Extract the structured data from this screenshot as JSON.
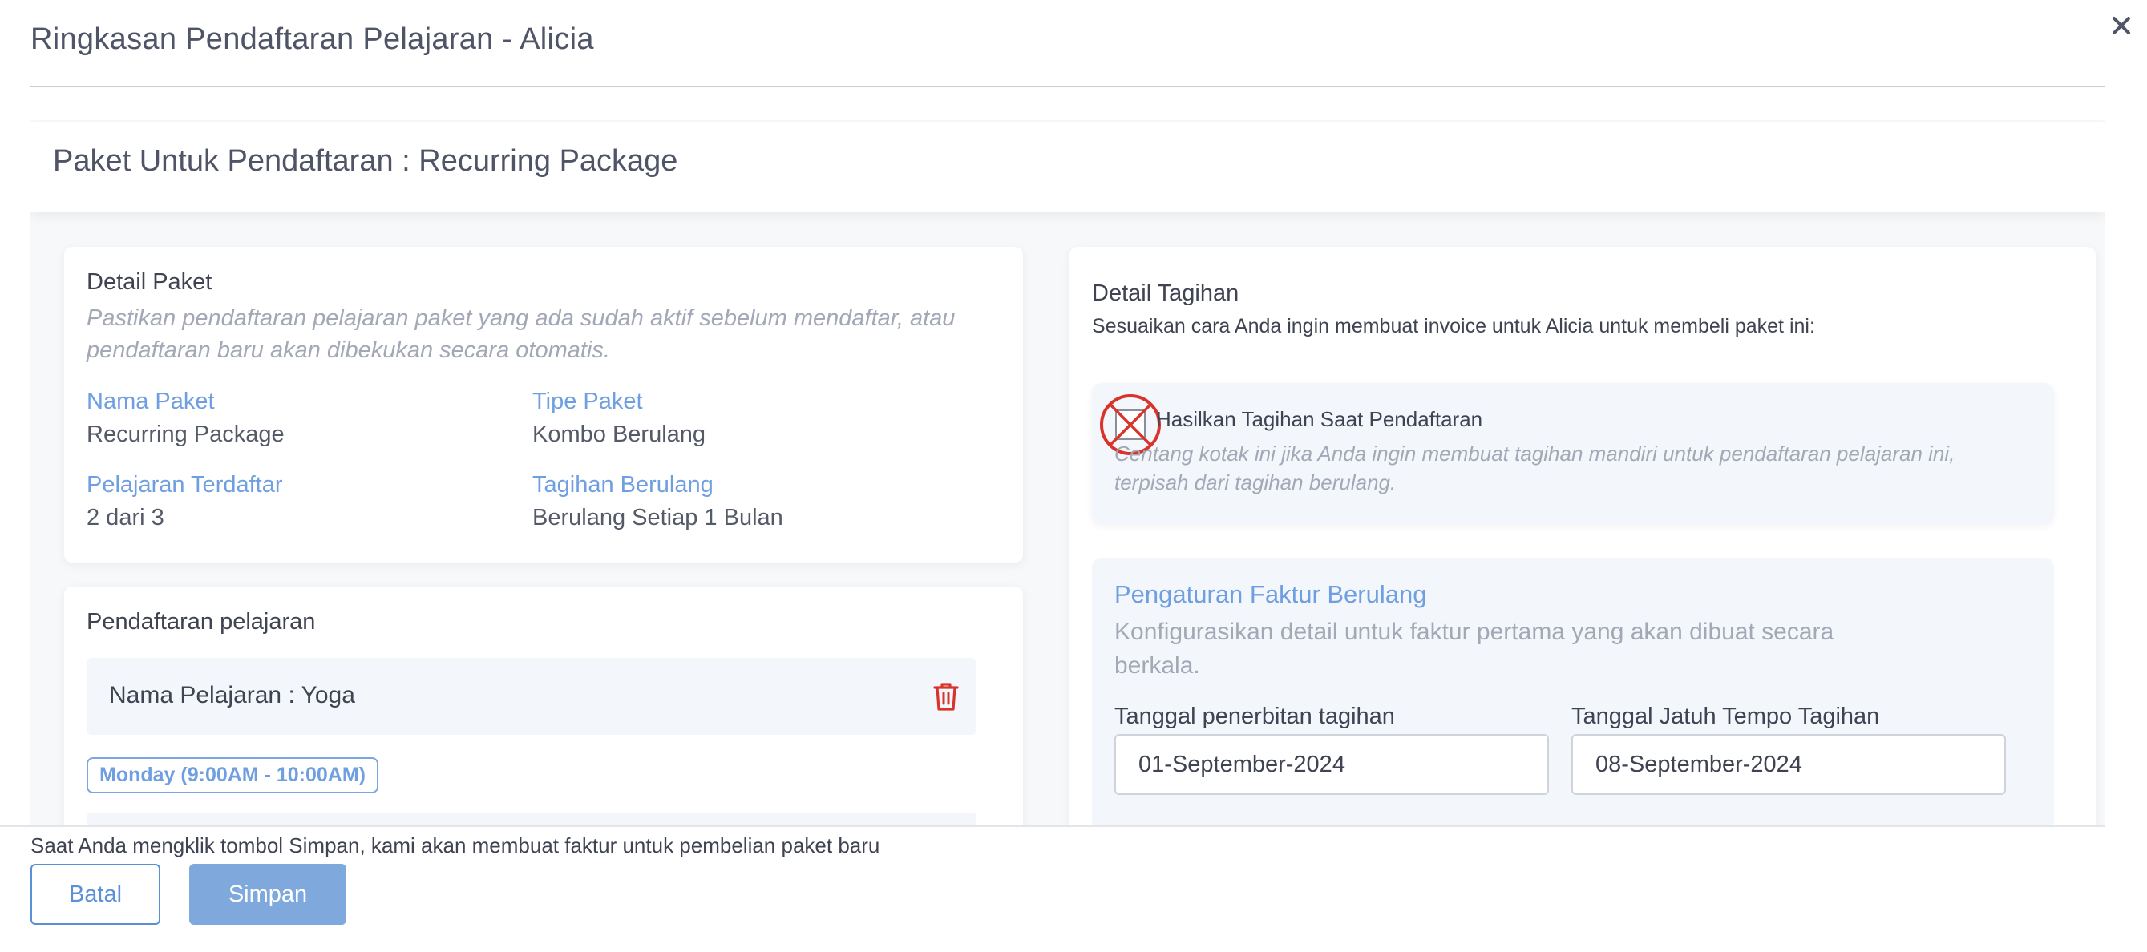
{
  "modal": {
    "title": "Ringkasan Pendaftaran Pelajaran - Alicia",
    "close_icon": "close-icon"
  },
  "package_header": {
    "text": "Paket Untuk Pendaftaran : Recurring Package"
  },
  "package_detail": {
    "title": "Detail Paket",
    "hint": "Pastikan pendaftaran pelajaran paket yang ada sudah aktif sebelum mendaftar, atau pendaftaran baru akan dibekukan secara otomatis.",
    "fields": [
      {
        "label": "Nama Paket",
        "value": "Recurring Package"
      },
      {
        "label": "Tipe Paket",
        "value": "Kombo Berulang"
      },
      {
        "label": "Pelajaran Terdaftar",
        "value": "2 dari 3"
      },
      {
        "label": "Tagihan Berulang",
        "value": "Berulang Setiap 1 Bulan"
      }
    ]
  },
  "enrollment": {
    "title": "Pendaftaran pelajaran",
    "lesson_name": "Nama Pelajaran : Yoga",
    "schedule": "Monday (9:00AM - 10:00AM)",
    "delete_icon": "trash-icon"
  },
  "billing": {
    "title": "Detail Tagihan",
    "subtitle": "Sesuaikan cara Anda ingin membuat invoice untuk Alicia untuk membeli paket ini:",
    "checkbox": {
      "label": "Hasilkan Tagihan Saat Pendaftaran",
      "hint": "Centang kotak ini jika Anda ingin membuat tagihan mandiri untuk pendaftaran pelajaran ini, terpisah dari tagihan berulang.",
      "checked": false
    },
    "recurring": {
      "title": "Pengaturan Faktur Berulang",
      "hint": "Konfigurasikan detail untuk faktur pertama yang akan dibuat secara berkala.",
      "issue_date_label": "Tanggal penerbitan tagihan",
      "issue_date_value": "01-September-2024",
      "due_date_label": "Tanggal Jatuh Tempo Tagihan",
      "due_date_value": "08-September-2024"
    }
  },
  "footer": {
    "note": "Saat Anda mengklik tombol Simpan, kami akan membuat faktur untuk pembelian paket baru",
    "cancel_label": "Batal",
    "save_label": "Simpan"
  },
  "colors": {
    "accent_blue": "#6f9fe0",
    "button_blue": "#5b8fd6",
    "save_disabled": "#7fa8dd",
    "danger_red": "#d9342b",
    "panel_bg": "#f3f7fc"
  }
}
